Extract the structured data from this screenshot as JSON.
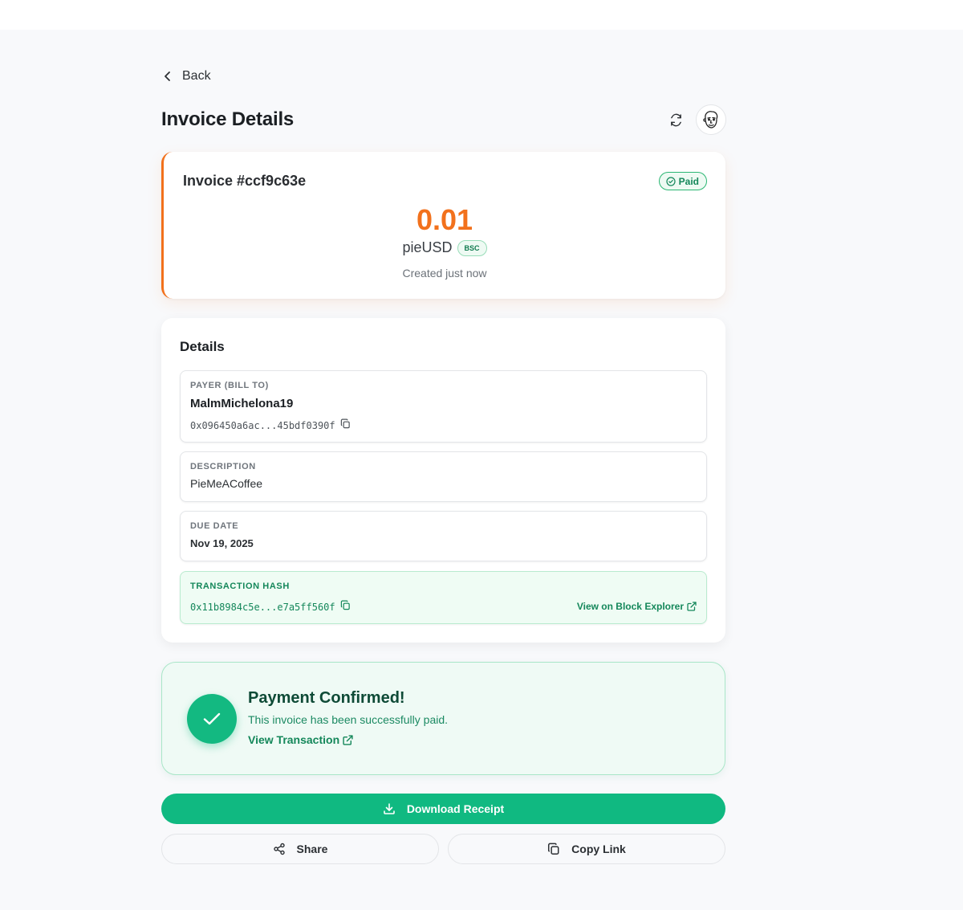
{
  "nav": {
    "back_label": "Back"
  },
  "header": {
    "title": "Invoice Details",
    "refresh_icon": "refresh-icon",
    "avatar_icon": "avatar-face-icon"
  },
  "invoice": {
    "number": "Invoice #ccf9c63e",
    "status": "Paid",
    "amount": "0.01",
    "currency": "pieUSD",
    "chain": "BSC",
    "created": "Created just now"
  },
  "details": {
    "title": "Details",
    "payer": {
      "label": "PAYER (BILL TO)",
      "name": "MalmMichelona19",
      "address": "0x096450a6ac...45bdf0390f"
    },
    "description": {
      "label": "DESCRIPTION",
      "value": "PieMeACoffee"
    },
    "due_date": {
      "label": "DUE DATE",
      "value": "Nov 19, 2025"
    },
    "transaction": {
      "label": "TRANSACTION HASH",
      "hash": "0x11b8984c5e...e7a5ff560f",
      "explorer_link": "View on Block Explorer"
    }
  },
  "confirmation": {
    "title": "Payment Confirmed!",
    "text": "This invoice has been successfully paid.",
    "link": "View Transaction"
  },
  "actions": {
    "download": "Download Receipt",
    "share": "Share",
    "copy_link": "Copy Link"
  },
  "colors": {
    "accent_orange": "#f2711c",
    "success_green": "#10b981",
    "success_text": "#14875a",
    "page_bg": "#f8f9fb"
  }
}
